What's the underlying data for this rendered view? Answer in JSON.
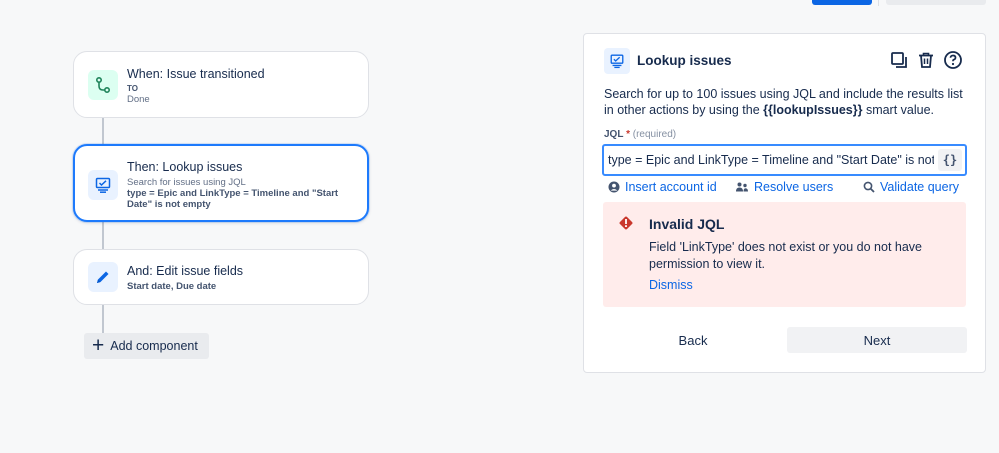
{
  "flow": {
    "trigger": {
      "title": "When: Issue transitioned",
      "line1": "TO",
      "line2": "Done",
      "icon": "transition-icon",
      "color": "#1f845a"
    },
    "action": {
      "title": "Then: Lookup issues",
      "subtitle": "Search for issues using JQL",
      "detail": "type = Epic and LinkType = Timeline and \"Start Date\" is not empty",
      "icon": "lookup-icon",
      "color": "#0c66e4"
    },
    "edit": {
      "title": "And: Edit issue fields",
      "detail": "Start date, Due date",
      "icon": "pencil-icon",
      "color": "#0c66e4"
    },
    "add_component_label": "Add component"
  },
  "panel": {
    "title": "Lookup issues",
    "description_pre": "Search for up to 100 issues using JQL and include the results list in other actions by using the ",
    "description_smart_value": "{{lookupIssues}}",
    "description_post": " smart value.",
    "jql_label": "JQL",
    "jql_required_mark": "*",
    "jql_required_text": "(required)",
    "jql_value": "type = Epic and LinkType = Timeline and \"Start Date\" is not empty",
    "smart_value_button": "{}",
    "links": {
      "insert_account": "Insert account id",
      "resolve_users": "Resolve users",
      "validate_query": "Validate query"
    },
    "error": {
      "title": "Invalid JQL",
      "message": "Field 'LinkType' does not exist or you do not have permission to view it.",
      "dismiss": "Dismiss",
      "color": "#c9372c"
    },
    "back_label": "Back",
    "next_label": "Next"
  }
}
